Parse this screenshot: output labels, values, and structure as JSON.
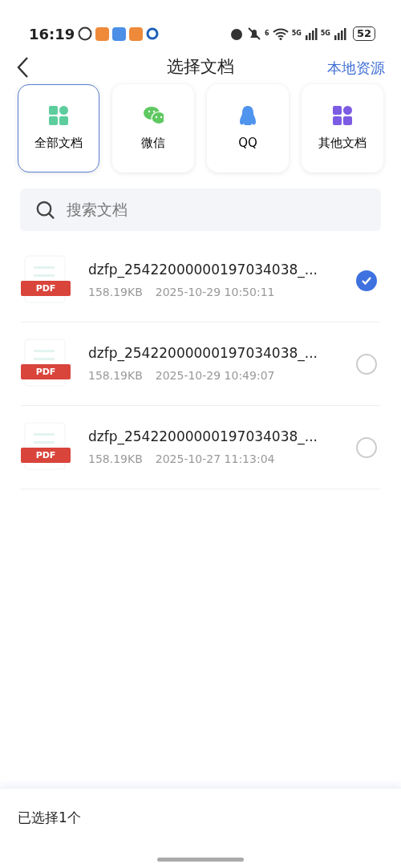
{
  "status_bar": {
    "time": "16:19",
    "wifi_label": "6",
    "network_labels": [
      "5G",
      "5G"
    ],
    "battery": "52"
  },
  "nav": {
    "title": "选择文档",
    "action": "本地资源"
  },
  "categories": [
    {
      "label": "全部文档",
      "kind": "all",
      "selected": true
    },
    {
      "label": "微信",
      "kind": "wechat",
      "selected": false
    },
    {
      "label": "QQ",
      "kind": "qq",
      "selected": false
    },
    {
      "label": "其他文档",
      "kind": "other",
      "selected": false
    }
  ],
  "search": {
    "placeholder": "搜索文档"
  },
  "files": [
    {
      "badge": "PDF",
      "name": "dzfp_25422000000197034038_...",
      "size": "158.19KB",
      "date": "2025-10-29 10:50:11",
      "selected": true
    },
    {
      "badge": "PDF",
      "name": "dzfp_25422000000197034038_...",
      "size": "158.19KB",
      "date": "2025-10-29 10:49:07",
      "selected": false
    },
    {
      "badge": "PDF",
      "name": "dzfp_25422000000197034038_...",
      "size": "158.19KB",
      "date": "2025-10-27 11:13:04",
      "selected": false
    }
  ],
  "footer": {
    "selected_count": "已选择1个"
  }
}
